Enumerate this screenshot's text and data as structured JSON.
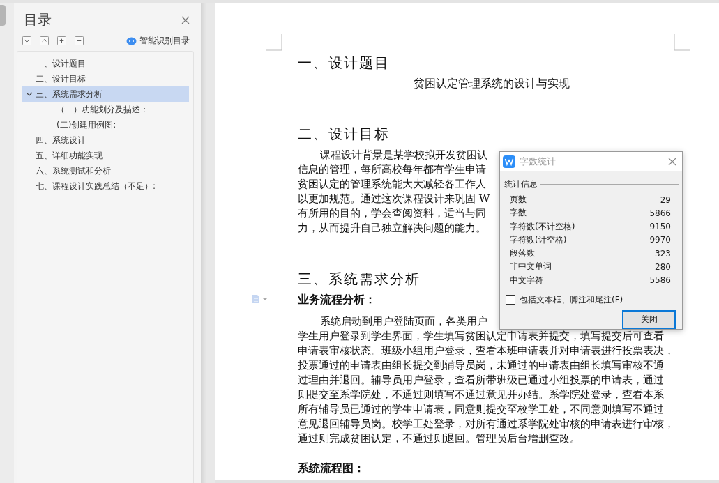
{
  "sidebar": {
    "title": "目录",
    "smart_button": "智能识别目录",
    "toc": [
      {
        "label": "一、设计题目",
        "selected": false
      },
      {
        "label": "二、设计目标",
        "selected": false
      },
      {
        "label": "三、系统需求分析",
        "selected": true,
        "expanded": true,
        "children": [
          {
            "label": "（一）功能划分及描述：",
            "selected": false
          },
          {
            "label": "(二)创建用例图:",
            "selected": false
          }
        ]
      },
      {
        "label": "四、系统设计",
        "selected": false
      },
      {
        "label": "五、详细功能实现",
        "selected": false
      },
      {
        "label": "六、系统测试和分析",
        "selected": false
      },
      {
        "label": "七、课程设计实践总结（不足）:",
        "selected": false
      }
    ]
  },
  "document": {
    "blocks": [
      {
        "kind": "heading",
        "text": "一、设计题目"
      },
      {
        "kind": "title",
        "text": "贫困认定管理系统的设计与实现"
      },
      {
        "kind": "heading",
        "text": "二、设计目标"
      },
      {
        "kind": "paragraph",
        "lines": [
          "课程设计背景是某学校拟开发贫困认",
          "信息的管理，每所高校每年都有学生申请",
          "贫困认定的管理系统能大大减轻各工作人",
          "以更加规范。通过这次课程设计来巩固 W",
          "有所用的目的，学会查阅资料，适当与同",
          "力，从而提升自己独立解决问题的能力。"
        ]
      },
      {
        "kind": "heading",
        "text": "三、系统需求分析"
      },
      {
        "kind": "subheading",
        "text": "业务流程分析：",
        "marker": true
      },
      {
        "kind": "paragraph",
        "lines": [
          "系统启动到用户登陆页面，各类用户",
          "学生用户登录到学生界面，学生填写贫困认定申请表并提交，填写提交后可查看",
          "申请表审核状态。班级小组用户登录，查看本班申请表并对申请表进行投票表决，",
          "投票通过的申请表由组长提交到辅导员岗，未通过的申请表由组长填写审核不通",
          "过理由并退回。辅导员用户登录，查看所带班级已通过小组投票的申请表，通过",
          "则提交至系学院处，不通过则填写不通过意见并办结。系学院处登录，查看本系",
          "所有辅导员已通过的学生申请表，同意则提交至校学工处，不同意则填写不通过",
          "意见退回辅导员岗。校学工处登录，对所有通过系学院处审核的申请表进行审核，",
          "通过则完成贫困认定，不通过则退回。管理员后台增删查改。"
        ]
      },
      {
        "kind": "subheading",
        "text": "系统流程图："
      }
    ]
  },
  "dialog": {
    "title": "字数统计",
    "section": "统计信息",
    "stats": [
      {
        "label": "页数",
        "value": "29"
      },
      {
        "label": "字数",
        "value": "5866"
      },
      {
        "label": "字符数(不计空格)",
        "value": "9150"
      },
      {
        "label": "字符数(计空格)",
        "value": "9970"
      },
      {
        "label": "段落数",
        "value": "323"
      },
      {
        "label": "非中文单词",
        "value": "280"
      },
      {
        "label": "中文字符",
        "value": "5586"
      }
    ],
    "checkbox": {
      "label": "包括文本框、脚注和尾注(F)",
      "checked": false
    },
    "button": "关闭"
  }
}
